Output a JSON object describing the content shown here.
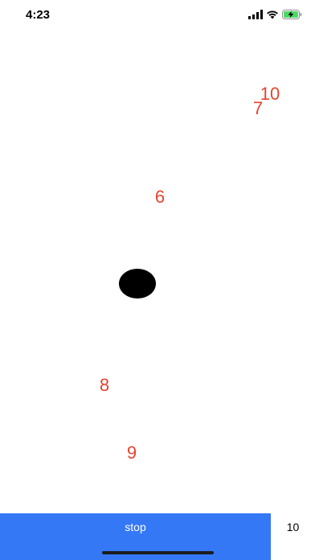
{
  "status_bar": {
    "time": "4:23",
    "icons": [
      "cellular-signal-icon",
      "wifi-icon",
      "battery-charging-icon"
    ]
  },
  "game": {
    "numbers": [
      "10",
      "7",
      "6",
      "8",
      "9"
    ],
    "ball": "black-ball",
    "number_color": "#e8432e"
  },
  "bottom_bar": {
    "stop_label": "stop",
    "counter": "10",
    "button_color": "#3478f6"
  }
}
